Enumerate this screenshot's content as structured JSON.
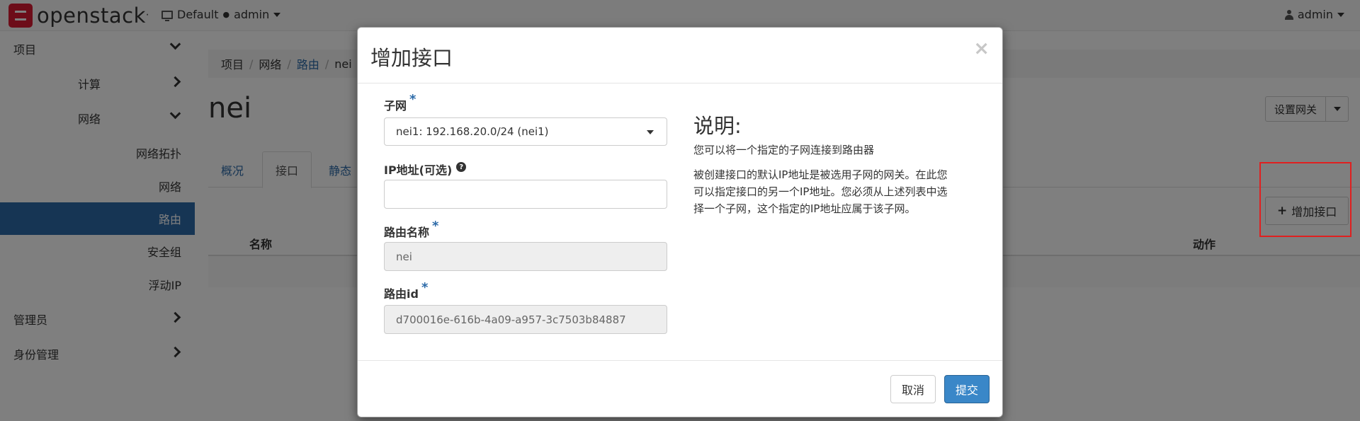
{
  "navbar": {
    "brand": "openstack",
    "brand_mark": ".",
    "project": "Default",
    "project_sep": "●",
    "project_user": "admin",
    "user": "admin"
  },
  "sidebar": {
    "items": [
      {
        "label": "项目"
      },
      {
        "label": "计算"
      },
      {
        "label": "网络"
      },
      {
        "label": "网络拓扑"
      },
      {
        "label": "网络"
      },
      {
        "label": "路由"
      },
      {
        "label": "安全组"
      },
      {
        "label": "浮动IP"
      },
      {
        "label": "管理员"
      },
      {
        "label": "身份管理"
      }
    ]
  },
  "breadcrumb": {
    "items": [
      "项目",
      "网络",
      "路由",
      "nei"
    ],
    "separator": "/"
  },
  "page": {
    "title": "nei",
    "gateway_button": "设置网关",
    "tabs": [
      "概况",
      "接口",
      "静态"
    ],
    "add_interface_button": "增加接口",
    "table_headers": [
      "名称",
      "动作"
    ]
  },
  "modal": {
    "title": "增加接口",
    "close": "×",
    "subnet_label": "子网",
    "subnet_value": "nei1: 192.168.20.0/24 (nei1)",
    "ip_label": "IP地址(可选)",
    "ip_value": "",
    "router_name_label": "路由名称",
    "router_name_value": "nei",
    "router_id_label": "路由id",
    "router_id_value": "d700016e-616b-4a09-a957-3c7503b84887",
    "required_mark": "*",
    "help_mark": "?",
    "desc_title": "说明:",
    "desc_p1": "您可以将一个指定的子网连接到路由器",
    "desc_p2_line1": "被创建接口的默认IP地址是被选用子网的网关。在此您",
    "desc_p2_line2": "可以指定接口的另一个IP地址。您必须从上述列表中选",
    "desc_p2_line3": "择一个子网，这个指定的IP地址应属于该子网。",
    "cancel": "取消",
    "submit": "提交"
  },
  "colors": {
    "accent": "#2c6aa8",
    "submit": "#3a87c8",
    "highlight": "#e02020",
    "brand_red": "#da1a32"
  }
}
